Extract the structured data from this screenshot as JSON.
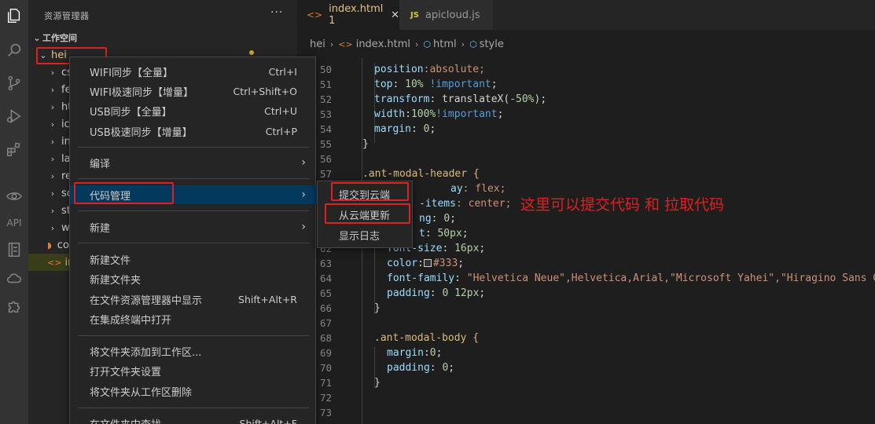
{
  "activity_bar": {
    "items": [
      "explorer-icon",
      "search-icon",
      "source-control-icon",
      "run-debug-icon",
      "extensions-icon",
      "eye-icon",
      "api",
      "remote-icon",
      "cloud-icon",
      "puzzle-icon"
    ],
    "api_label": "API"
  },
  "sidebar": {
    "title": "资源管理器",
    "more": "···",
    "workspace": "工作空间",
    "folder": "hei",
    "items": [
      {
        "label": "cs"
      },
      {
        "label": "fe"
      },
      {
        "label": "ht"
      },
      {
        "label": "ic"
      },
      {
        "label": "in"
      },
      {
        "label": "la"
      },
      {
        "label": "re"
      },
      {
        "label": "sc"
      },
      {
        "label": "st"
      },
      {
        "label": "w"
      },
      {
        "label": "co"
      },
      {
        "label": "in"
      }
    ]
  },
  "tabs": [
    {
      "label": "index.html 1",
      "active": true,
      "close": "✕"
    },
    {
      "label": "apicloud.js",
      "active": false,
      "icon": "JS"
    }
  ],
  "breadcrumb": [
    "hei",
    "index.html",
    "html",
    "style"
  ],
  "code": {
    "lines": [
      {
        "n": "50",
        "t": ""
      },
      {
        "n": "51",
        "t": ""
      },
      {
        "n": "52",
        "t": ""
      },
      {
        "n": "53",
        "t": ""
      },
      {
        "n": "54",
        "t": ""
      },
      {
        "n": "55",
        "t": ""
      },
      {
        "n": "56",
        "t": ""
      },
      {
        "n": "57",
        "t": ""
      },
      {
        "n": "58",
        "t": ""
      },
      {
        "n": "59",
        "t": ""
      },
      {
        "n": "60",
        "t": ""
      },
      {
        "n": "61",
        "t": ""
      },
      {
        "n": "62",
        "t": ""
      },
      {
        "n": "63",
        "t": ""
      },
      {
        "n": "64",
        "t": ""
      },
      {
        "n": "65",
        "t": ""
      },
      {
        "n": "66",
        "t": ""
      },
      {
        "n": "67",
        "t": ""
      },
      {
        "n": "68",
        "t": ""
      },
      {
        "n": "69",
        "t": ""
      },
      {
        "n": "70",
        "t": ""
      },
      {
        "n": "71",
        "t": ""
      },
      {
        "n": "72",
        "t": ""
      },
      {
        "n": "73",
        "t": ""
      }
    ],
    "segments": {
      "l50a": "position",
      "l50b": ":absolute;",
      "l51a": "top",
      "l51b": ": ",
      "l51c": "10%",
      "l51d": " !important",
      "l51e": ";",
      "l52a": "transform",
      "l52b": ": translateX(",
      "l52c": "-50%",
      "l52d": ");",
      "l53a": "width",
      "l53b": ":",
      "l53c": "100%",
      "l53d": "!important",
      "l53e": ";",
      "l54a": "margin",
      "l54b": ": ",
      "l54c": "0",
      "l54d": ";",
      "l55": "}",
      "l57": ".ant-modal-header {",
      "l58a": "ay",
      "l58b": ": flex;",
      "l59a": "-items",
      "l59b": ": center;",
      "l60a": "ng",
      "l60b": ": ",
      "l60c": "0",
      "l60d": ";",
      "l61a": "t",
      "l61b": ": ",
      "l61c": "50px",
      "l61d": ";",
      "l62a": "font-size",
      "l62b": ": ",
      "l62c": "16px",
      "l62d": ";",
      "l63a": "color",
      "l63b": ":",
      "l63c": "#333",
      "l63d": ";",
      "l64a": "font-family",
      "l64b": ": ",
      "l64c": "\"Helvetica Neue\"",
      "l64d": ",Helvetica,Arial,",
      "l64e": "\"Microsoft Yahei\"",
      "l64f": ",",
      "l64g": "\"Hiragino Sans GB\"",
      "l65a": "padding",
      "l65b": ": ",
      "l65c": "0 12px",
      "l65d": ";",
      "l66": "}",
      "l68": ".ant-modal-body {",
      "l69a": "margin",
      "l69b": ":",
      "l69c": "0",
      "l69d": ";",
      "l70a": "padding",
      "l70b": ": ",
      "l70c": "0",
      "l70d": ";",
      "l71": "}"
    }
  },
  "context_menu": {
    "items": [
      {
        "label": "WIFI同步【全量】",
        "key": "Ctrl+I"
      },
      {
        "label": "WIFI极速同步【增量】",
        "key": "Ctrl+Shift+O"
      },
      {
        "label": "USB同步【全量】",
        "key": "Ctrl+U"
      },
      {
        "label": "USB极速同步【增量】",
        "key": "Ctrl+P"
      },
      {
        "label": "编译",
        "arrow": "›"
      },
      {
        "label": "代码管理",
        "arrow": "›"
      },
      {
        "label": "新建",
        "arrow": "›"
      },
      {
        "label": "新建文件"
      },
      {
        "label": "新建文件夹"
      },
      {
        "label": "在文件资源管理器中显示",
        "key": "Shift+Alt+R"
      },
      {
        "label": "在集成终端中打开"
      },
      {
        "label": "将文件夹添加到工作区..."
      },
      {
        "label": "打开文件夹设置"
      },
      {
        "label": "将文件夹从工作区删除"
      },
      {
        "label": "在文件夹中查找...",
        "key": "Shift+Alt+F"
      }
    ]
  },
  "submenu": {
    "items": [
      {
        "label": "提交到云端"
      },
      {
        "label": "从云端更新"
      },
      {
        "label": "显示日志"
      }
    ]
  },
  "annotation": "这里可以提交代码  和  拉取代码",
  "colors": {
    "accent_red": "#e02020",
    "folder_yellow": "#e2c08d",
    "menu_bg": "#252526"
  }
}
